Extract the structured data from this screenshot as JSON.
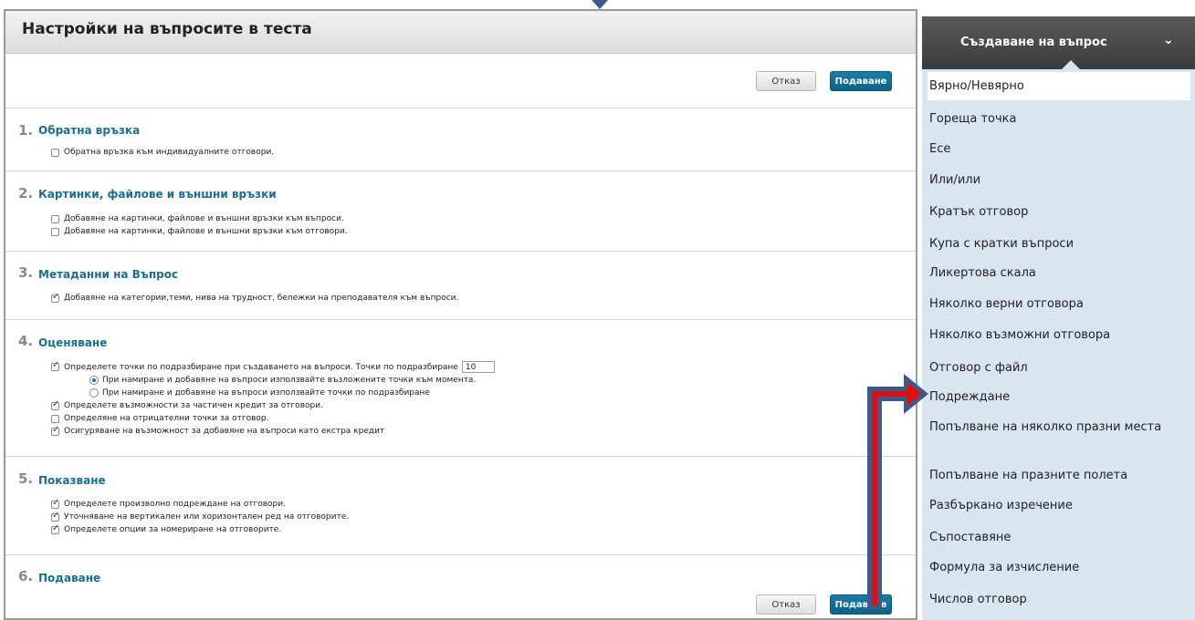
{
  "page": {
    "title": "Настройки на въпросите в теста",
    "cancel_label": "Отказ",
    "submit_label": "Подаване"
  },
  "sections": [
    {
      "num": "1.",
      "title": "Обратна връзка",
      "options": [
        {
          "text": "Обратна връзка към индивидуалните отговори.",
          "checked": false
        }
      ]
    },
    {
      "num": "2.",
      "title": "Картинки, файлове и външни връзки",
      "options": [
        {
          "text": "Добавяне на картинки, файлове и външни връзки към въпроси.",
          "checked": false
        },
        {
          "text": "Добавяне на картинки, файлове и външни връзки към отговори.",
          "checked": false
        }
      ]
    },
    {
      "num": "3.",
      "title": "Метаданни на Въпрос",
      "options": [
        {
          "text": "Добавяне на категории,теми, нива на трудност, бележки на преподавателя към въпроси.",
          "checked": true
        }
      ]
    },
    {
      "num": "4.",
      "title": "Оценяване",
      "default_points_label": "Определете точки по подразбиране при създаването на въпроси. Точки по подразбиране",
      "default_points_value": "10",
      "radio_1": "При намиране и добавяне на въпроси използвайте възложените точки към момента.",
      "radio_2": "При намиране и добавяне на въпроси използвайте точки по подразбиране",
      "options": [
        {
          "text": "Определете възможности за частичен кредит за отговори.",
          "checked": true
        },
        {
          "text": "Определяне на отрицателни точки за отговор.",
          "checked": false
        },
        {
          "text": "Осигуряване на възможност за добавяне на въпроси като екстра кредит",
          "checked": true
        }
      ]
    },
    {
      "num": "5.",
      "title": "Показване",
      "options": [
        {
          "text": "Определете произволно подреждане на отговори.",
          "checked": true
        },
        {
          "text": "Уточняване на вертикален или хоризонтален ред на отговорите.",
          "checked": true
        },
        {
          "text": "Определете опции за номериране на отговорите.",
          "checked": true
        }
      ]
    },
    {
      "num": "6.",
      "title": "Подаване"
    }
  ],
  "create_menu": {
    "label": "Създаване на въпрос",
    "items": [
      "Вярно/Невярно",
      "Гореща точка",
      "Есе",
      "Или/или",
      "Кратък отговор",
      "Купа с кратки въпроси",
      "Ликертова скала",
      "Няколко верни отговора",
      "Няколко възможни отговора",
      "Отговор с файл",
      "Подреждане",
      "Попълване на няколко празни места",
      "Попълване на празните полета",
      "Разбъркано изречение",
      "Съпоставяне",
      "Формула за изчисление",
      "Числов отговор"
    ]
  },
  "colors": {
    "accent": "#1a6e94",
    "menu_bg": "#d9e5f0",
    "annotation_arrow": "#e01010",
    "annotation_outline": "#3c5a8c"
  }
}
